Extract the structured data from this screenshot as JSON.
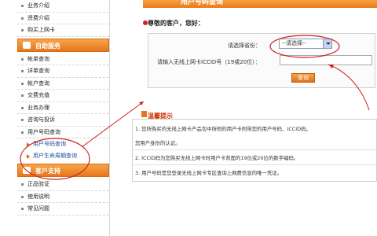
{
  "sidebar": {
    "top_items": [
      "业务介绍",
      "资费介绍",
      "购买上网卡"
    ],
    "section1": "自助服务",
    "section1_items": [
      "帐单查询",
      "详单查询",
      "帐户查询",
      "交费充值",
      "业务办理",
      "咨询与投诉",
      "用户号码查询"
    ],
    "sub_items": [
      "用户号码查询",
      "用户生命周期查询"
    ],
    "section2": "客户支持",
    "section2_items": [
      "正品验证",
      "使用说明",
      "常见问题"
    ]
  },
  "main": {
    "title": "用户号码查询",
    "greeting": "尊敬的客户，您好：",
    "form": {
      "province_label": "请选择省份：",
      "province_value": "--请选择--",
      "iccid_label": "请输入无线上网卡ICCID号（19或20位）：",
      "query_button": "查询"
    },
    "tips": {
      "title": "温馨提示",
      "items": [
        "1. 您所购买的无线上网卡产品包中所附的用户卡附带您的用户号码、ICCID码。",
        "您用户身份的认证。",
        "2. ICCID码为您购买无线上网卡时用户卡背面的19位或20位的数字编码。",
        "3. 用户号码是您登录无线上网卡专区查询上网费信息的唯一凭证。"
      ]
    }
  },
  "colors": {
    "accent": "#e8761c",
    "annotation": "#cc2222"
  }
}
